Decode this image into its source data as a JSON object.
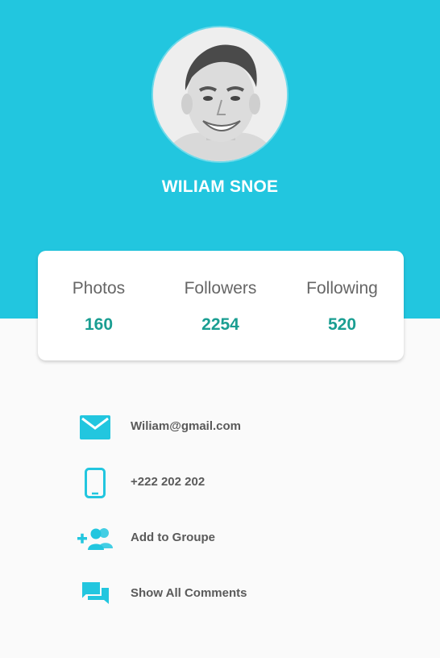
{
  "profile": {
    "name": "WILIAM SNOE",
    "avatar_icon": "profile-photo"
  },
  "stats": [
    {
      "label": "Photos",
      "value": "160"
    },
    {
      "label": "Followers",
      "value": "2254"
    },
    {
      "label": "Following",
      "value": "520"
    }
  ],
  "actions": [
    {
      "icon": "email-icon",
      "label": "Wiliam@gmail.com"
    },
    {
      "icon": "phone-icon",
      "label": "+222 202 202"
    },
    {
      "icon": "add-group-icon",
      "label": "Add to Groupe"
    },
    {
      "icon": "comments-icon",
      "label": "Show All Comments"
    }
  ],
  "colors": {
    "header_bg": "#22c6df",
    "accent": "#22c6df",
    "stat_value": "#1a9e92",
    "page_bg": "#fafafa"
  }
}
